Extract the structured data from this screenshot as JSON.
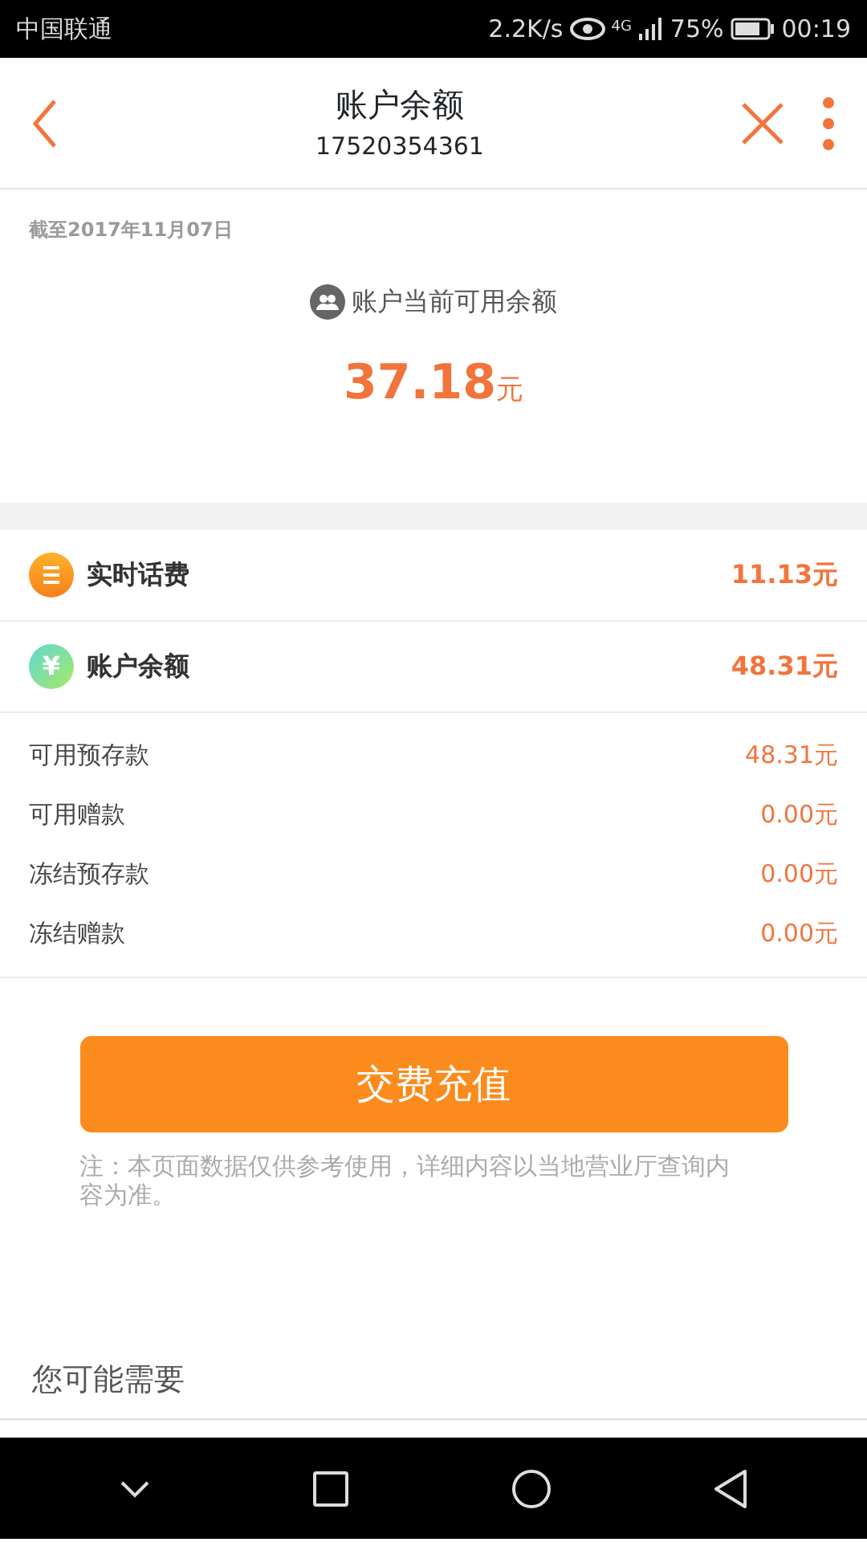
{
  "status_bar": {
    "carrier": "中国联通",
    "speed": "2.2K/s",
    "network": "4G",
    "battery": "75%",
    "time": "00:19"
  },
  "header": {
    "title": "账户余额",
    "subtitle": "17520354361"
  },
  "summary": {
    "date": "截至2017年11月07日",
    "label": "账户当前可用余额",
    "amount": "37.18",
    "unit": "元"
  },
  "main_rows": [
    {
      "kind": "bill",
      "label": "实时话费",
      "amount": "11.13元"
    },
    {
      "kind": "balance",
      "icon_text": "¥",
      "label": "账户余额",
      "amount": "48.31元"
    }
  ],
  "detail_rows": [
    {
      "label": "可用预存款",
      "amount": "48.31元"
    },
    {
      "label": "可用赠款",
      "amount": "0.00元"
    },
    {
      "label": "冻结预存款",
      "amount": "0.00元"
    },
    {
      "label": "冻结赠款",
      "amount": "0.00元"
    }
  ],
  "button": "交费充值",
  "note": "注：本页面数据仅供参考使用，详细内容以当地营业厅查询内容为准。",
  "section_title": "您可能需要"
}
